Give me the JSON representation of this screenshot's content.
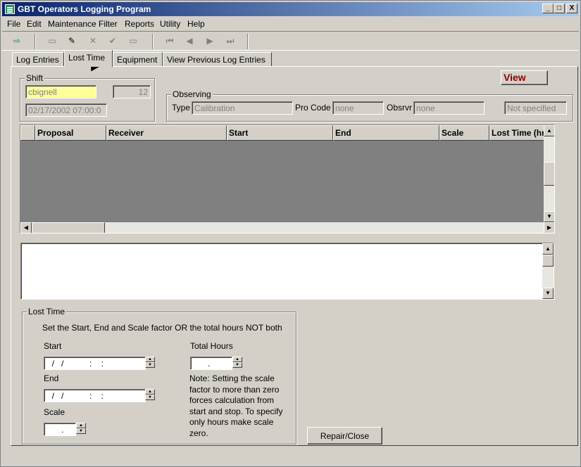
{
  "window": {
    "title": "GBT Operators Logging Program",
    "min": "_",
    "max": "□",
    "close": "X"
  },
  "menu": [
    "File",
    "Edit",
    "Maintenance",
    "Filter",
    "Reports",
    "Utility",
    "Help"
  ],
  "toolbar": {
    "icons": [
      "exit-icon",
      "add-record-icon",
      "edit-record-icon",
      "delete-record-icon",
      "save-record-icon",
      "cancel-record-icon",
      "first-record-icon",
      "prev-record-icon",
      "next-record-icon",
      "last-record-icon"
    ],
    "glyphs": [
      "⇨",
      "▭",
      "✎",
      "✕",
      "✔",
      "▭",
      "⏮",
      "◀",
      "▶",
      "⏭"
    ]
  },
  "tabs": [
    "Log Entries",
    "Lost Time",
    "Equipment",
    "View Previous Log Entries"
  ],
  "view_button": "View",
  "shift": {
    "label": "Shift",
    "operator": "cbignell",
    "number": "12",
    "datetime": "02/17/2002  07:00:0"
  },
  "observing": {
    "label": "Observing",
    "type_label": "Type",
    "type_value": "Calibration",
    "procode_label": "Pro Code",
    "procode_value": "none",
    "observer_label": "Obsrvr",
    "observer_value": "none",
    "status": "Not specified"
  },
  "grid": {
    "columns": [
      "Proposal",
      "Receiver",
      "Start",
      "End",
      "Scale",
      "Lost Time (hr"
    ]
  },
  "lost_time": {
    "label": "Lost Time",
    "instruction": "Set the Start, End and Scale factor OR the total hours NOT both",
    "start_label": "Start",
    "start_value": "  /   /           :    :",
    "end_label": "End",
    "end_value": "  /   /           :    :",
    "scale_label": "Scale",
    "scale_value": "      .",
    "total_label": "Total Hours",
    "total_value": "      .",
    "note_lines": [
      "Note:  Setting the scale",
      "factor to more than zero",
      "forces calculation from",
      "start and stop.  To specify",
      "only hours make scale",
      "zero."
    ]
  },
  "repair_button": "Repair/Close"
}
